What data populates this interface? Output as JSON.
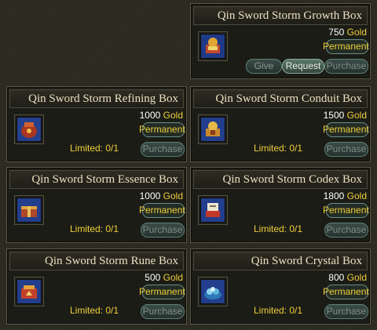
{
  "currency": "Gold",
  "permanent_label": "Permanent",
  "limited_label": "Limited: 0/1",
  "purchase_label": "Purchase",
  "give_label": "Give",
  "request_label": "Request",
  "colors": {
    "gold_text": "#f0cf3b",
    "title_text": "#e9dfc1",
    "panel_bg": "#1b1c16"
  },
  "items": [
    {
      "name": "Qin Sword Storm Growth Box",
      "price": "750",
      "icon": "growth-box-icon"
    },
    {
      "name": "Qin Sword Storm Refining Box",
      "price": "1000",
      "icon": "refining-box-icon"
    },
    {
      "name": "Qin Sword Storm Conduit Box",
      "price": "1500",
      "icon": "conduit-box-icon"
    },
    {
      "name": "Qin Sword Storm Essence Box",
      "price": "1000",
      "icon": "essence-box-icon"
    },
    {
      "name": "Qin Sword Storm Codex Box",
      "price": "1800",
      "icon": "codex-box-icon"
    },
    {
      "name": "Qin Sword Storm Rune Box",
      "price": "500",
      "icon": "rune-box-icon"
    },
    {
      "name": "Qin Sword Crystal Box",
      "price": "800",
      "icon": "crystal-box-icon"
    }
  ]
}
